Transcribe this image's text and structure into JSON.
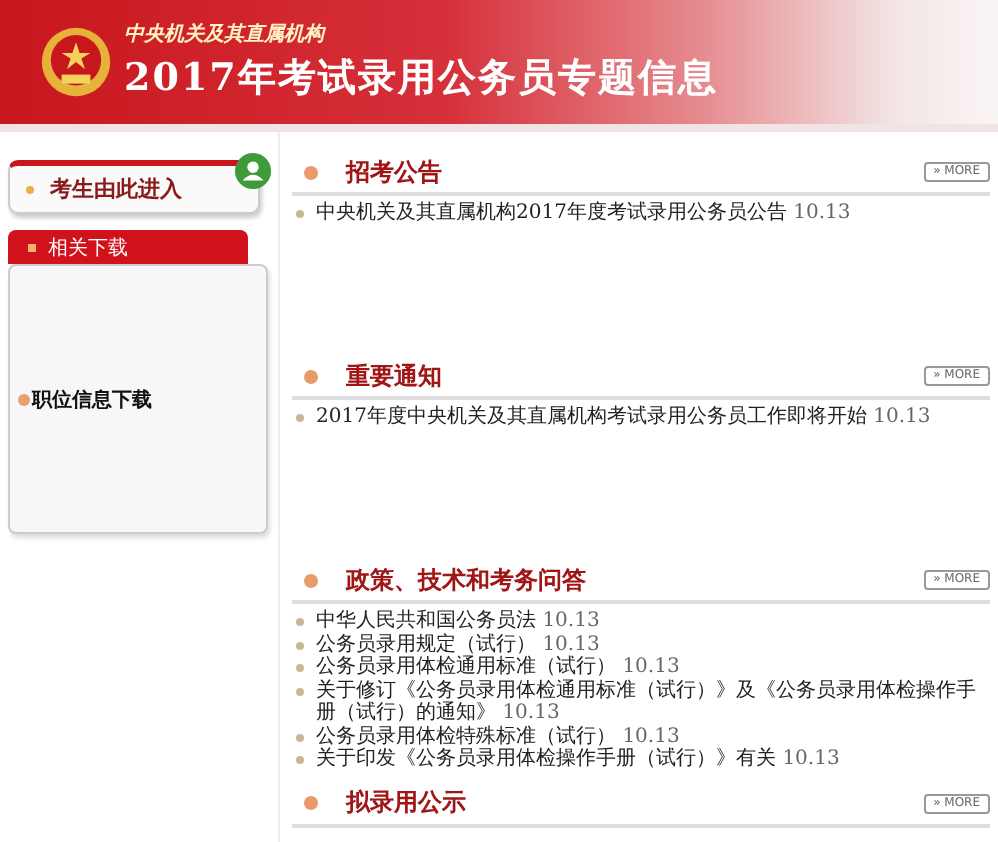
{
  "header": {
    "subtitle": "中央机关及其直属机构",
    "title": "2017年考试录用公务员专题信息"
  },
  "sidebar": {
    "enter_button": "考生由此进入",
    "downloads": {
      "title": "相关下载",
      "items": [
        "职位信息下载"
      ]
    }
  },
  "sections": [
    {
      "title": "招考公告",
      "more": "» MORE",
      "items": [
        {
          "text": "中央机关及其直属机构2017年度考试录用公务员公告",
          "date": "10.13"
        }
      ]
    },
    {
      "title": "重要通知",
      "more": "» MORE",
      "items": [
        {
          "text": "2017年度中央机关及其直属机构考试录用公务员工作即将开始",
          "date": "10.13"
        }
      ]
    },
    {
      "title": "政策、技术和考务问答",
      "more": "» MORE",
      "items": [
        {
          "text": "中华人民共和国公务员法",
          "date": "10.13"
        },
        {
          "text": "公务员录用规定（试行）",
          "date": "10.13"
        },
        {
          "text": "公务员录用体检通用标准（试行）",
          "date": "10.13"
        },
        {
          "text": "关于修订《公务员录用体检通用标准（试行）》及《公务员录用体检操作手册（试行）的通知》",
          "date": "10.13"
        },
        {
          "text": "公务员录用体检特殊标准（试行）",
          "date": "10.13"
        },
        {
          "text": "关于印发《公务员录用体检操作手册（试行）》有关",
          "date": "10.13"
        }
      ]
    },
    {
      "title": "拟录用公示",
      "more": "» MORE"
    }
  ]
}
